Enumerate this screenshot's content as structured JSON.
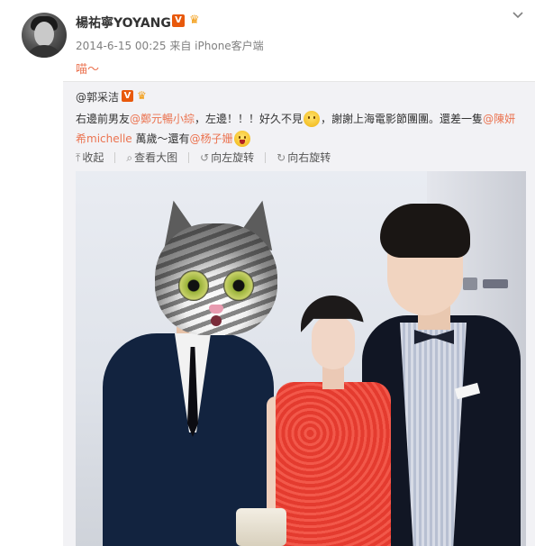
{
  "post": {
    "author_name": "楊祐寧YOYANG",
    "verified_badge": "V",
    "meta": {
      "timestamp": "2014-6-15 00:25",
      "source_prefix": "来自",
      "source_client": "iPhone客户端"
    },
    "text": "喵～",
    "icons": {
      "avatar": "avatar-image",
      "verified": "verified-v-icon",
      "vip": "crown-icon",
      "menu": "chevron-down-icon"
    }
  },
  "repost": {
    "author_handle": "@郭采洁",
    "verified_badge": "V",
    "text_segments": [
      {
        "type": "text",
        "value": "右邊前男友"
      },
      {
        "type": "mention",
        "value": "@鄭元暢小綜"
      },
      {
        "type": "text",
        "value": "，左邊！！！好久不見"
      },
      {
        "type": "emoji",
        "value": "thinking-emoji"
      },
      {
        "type": "text",
        "value": "，謝謝上海電影節團團。還差一隻"
      },
      {
        "type": "mention",
        "value": "@陳妍希michelle"
      },
      {
        "type": "text",
        "value": " 萬歲～還有"
      },
      {
        "type": "mention",
        "value": "@杨子姗"
      },
      {
        "type": "emoji",
        "value": "laughing-emoji"
      }
    ],
    "actions": [
      {
        "icon": "collapse-icon",
        "glyph": "⤒",
        "label": "收起"
      },
      {
        "icon": "zoom-icon",
        "glyph": "⌕",
        "label": "查看大图"
      },
      {
        "icon": "rotate-left-icon",
        "glyph": "↺",
        "label": "向左旋转"
      },
      {
        "icon": "rotate-right-icon",
        "glyph": "↻",
        "label": "向右旋转"
      }
    ],
    "photo": {
      "subject": "photo-of-three-people-at-event"
    }
  },
  "colors": {
    "mention": "#eb7350",
    "verified": "#e8590c",
    "vip_crown": "#f39c12",
    "repost_bg": "#f2f2f5",
    "meta_text": "#808080"
  }
}
